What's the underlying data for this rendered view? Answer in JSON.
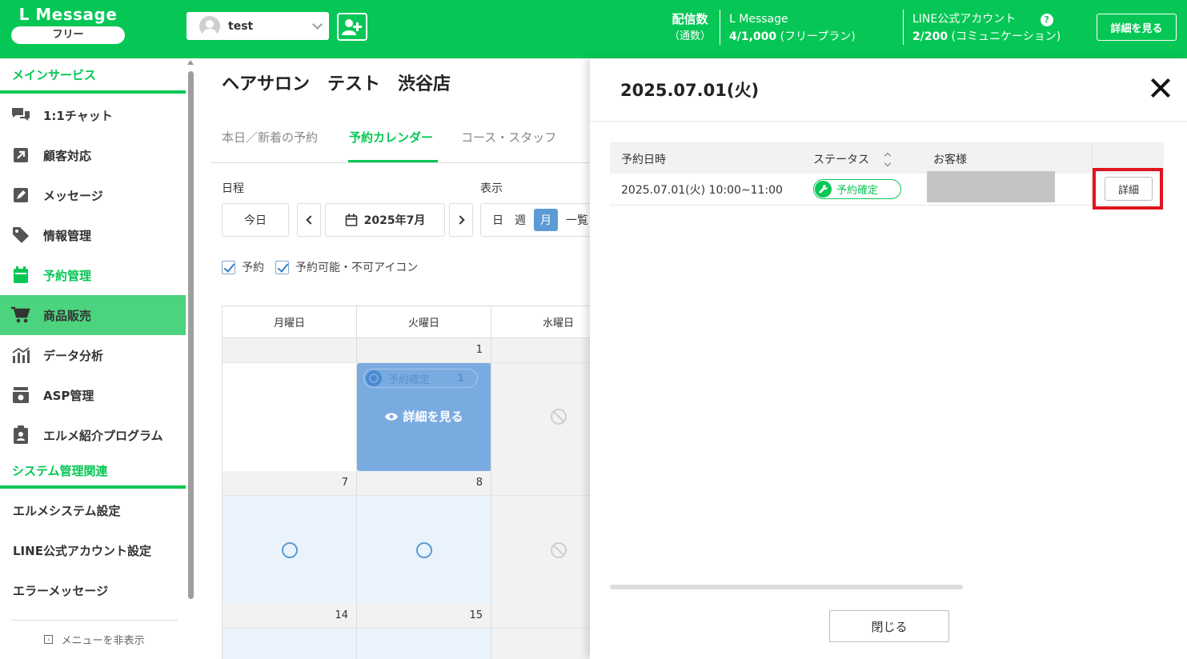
{
  "header": {
    "logo": "L Message",
    "plan_badge": "フリー",
    "account_name": "test",
    "delivery_label": "配信数",
    "delivery_sub": "（通数）",
    "lmessage_label": "L Message",
    "lmessage_count": "4/1,000",
    "lmessage_plan": "(フリープラン)",
    "line_label": "LINE公式アカウント",
    "line_count": "2/200",
    "line_plan": "(コミュニケーション)",
    "detail_button": "詳細を見る",
    "brand_color": "#06c755"
  },
  "sidebar": {
    "section_main": "メインサービス",
    "items": [
      {
        "label": "1:1チャット",
        "icon": "chat-icon"
      },
      {
        "label": "顧客対応",
        "icon": "arrow-box-icon"
      },
      {
        "label": "メッセージ",
        "icon": "pen-icon"
      },
      {
        "label": "情報管理",
        "icon": "tag-icon"
      },
      {
        "label": "予約管理",
        "icon": "calendar-icon"
      },
      {
        "label": "商品販売",
        "icon": "cart-icon"
      },
      {
        "label": "データ分析",
        "icon": "chart-icon"
      },
      {
        "label": "ASP管理",
        "icon": "register-icon"
      },
      {
        "label": "エルメ紹介プログラム",
        "icon": "clipboard-icon"
      }
    ],
    "section_system": "システム管理関連",
    "system_items": [
      "エルメシステム設定",
      "LINE公式アカウント設定",
      "エラーメッセージ"
    ],
    "hide_menu": "メニューを非表示"
  },
  "main": {
    "title": "ヘアサロン　テスト　渋谷店",
    "tabs": [
      "本日／新着の予約",
      "予約カレンダー",
      "コース・スタッフ"
    ],
    "schedule_label": "日程",
    "today_button": "今日",
    "month_label": "2025年7月",
    "view_label": "表示",
    "view_options": [
      "日",
      "週",
      "月",
      "一覧"
    ],
    "check_reservation": "予約",
    "check_availability": "予約可能・不可アイコン",
    "weekdays": [
      "月曜日",
      "火曜日",
      "水曜日"
    ],
    "day_numbers": {
      "tue_w1": "1",
      "mon_w2": "7",
      "tue_w2": "8",
      "mon_w3": "14",
      "tue_w3": "15"
    },
    "event": {
      "status": "予約確定",
      "count": "1",
      "detail": "詳細を見る"
    }
  },
  "panel": {
    "title": "2025.07.01(火)",
    "col_datetime": "予約日時",
    "col_status": "ステータス",
    "col_customer": "お客様",
    "row_datetime": "2025.07.01(火) 10:00~11:00",
    "row_status": "予約確定",
    "detail_button": "詳細",
    "close_button": "閉じる"
  }
}
